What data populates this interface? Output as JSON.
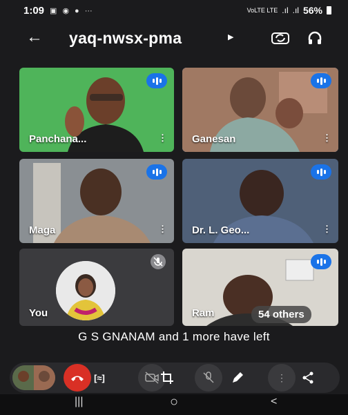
{
  "status_bar": {
    "time": "1:09",
    "icons": [
      "gallery-icon",
      "record-icon",
      "chat-icon",
      "more-icon"
    ],
    "signal_text": "VoLTE LTE",
    "battery_percent": "56%"
  },
  "header": {
    "meeting_code": "yaq-nwsx-pma",
    "back_icon": "back-arrow-icon",
    "camera_switch_icon": "camera-switch-icon",
    "audio_icon": "headphones-icon"
  },
  "participants": [
    {
      "name": "Panchana...",
      "speaking": true,
      "bg": "#4fb45a"
    },
    {
      "name": "Ganesan",
      "speaking": true,
      "bg": "#a07963",
      "selected": true
    },
    {
      "name": "Maga",
      "speaking": true,
      "bg": "#8a8f93"
    },
    {
      "name": "Dr. L. Geo...",
      "speaking": true,
      "bg": "#4f6078"
    },
    {
      "name": "You",
      "muted": true,
      "bg": "#3b3b3e"
    },
    {
      "name": "Ram",
      "speaking": true,
      "bg": "#d9d6cf"
    }
  ],
  "others_label": "54 others",
  "notice": "G S GNANAM and 1 more have left",
  "controls": {
    "colors": {
      "end_call": "#d93025",
      "speaking": "#1a73e8"
    },
    "icons": [
      "self-view-icon",
      "end-call-icon",
      "captions-icon",
      "camera-off-icon",
      "crop-icon",
      "mic-off-icon",
      "pen-icon",
      "more-vert-icon",
      "share-icon"
    ]
  },
  "navbar": {
    "recent": "|||",
    "home": "○",
    "back": "<"
  }
}
